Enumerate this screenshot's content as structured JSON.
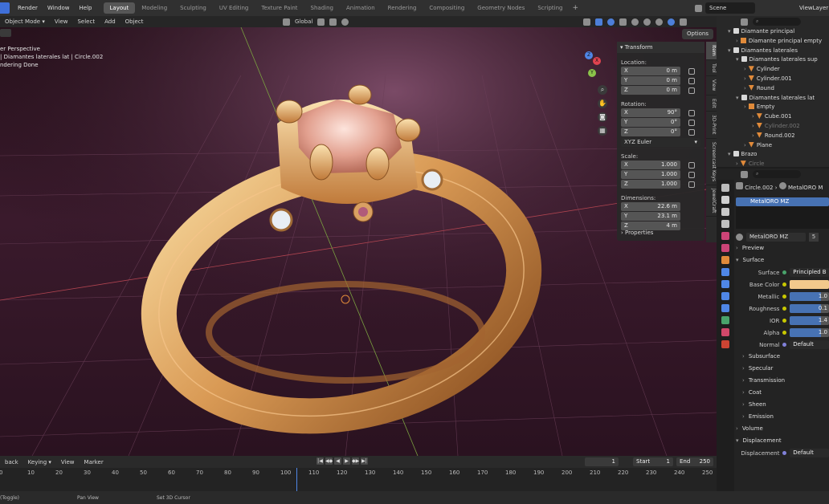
{
  "topbar": {
    "menus": [
      "Render",
      "Window",
      "Help"
    ],
    "workspaces": [
      "Layout",
      "Modeling",
      "Sculpting",
      "UV Editing",
      "Texture Paint",
      "Shading",
      "Animation",
      "Rendering",
      "Compositing",
      "Geometry Nodes",
      "Scripting"
    ],
    "active_workspace": "Layout",
    "add_tab": "+",
    "scene": "Scene",
    "view_layer": "ViewLayer"
  },
  "viewport_header": {
    "mode": "Object Mode",
    "menus": [
      "View",
      "Select",
      "Add",
      "Object"
    ],
    "orientation": "Global",
    "options": "Options"
  },
  "viewport_info": {
    "line1": "er Perspective",
    "line2": "| Diamantes laterales lat | Circle.002",
    "line3": "ndering Done"
  },
  "gizmo": {
    "x": "X",
    "y": "Y",
    "z": "Z"
  },
  "npanel": {
    "title": "Transform",
    "location_label": "Location:",
    "location": [
      {
        "axis": "X",
        "value": "0 m"
      },
      {
        "axis": "Y",
        "value": "0 m"
      },
      {
        "axis": "Z",
        "value": "0 m"
      }
    ],
    "rotation_label": "Rotation:",
    "rotation": [
      {
        "axis": "X",
        "value": "90°"
      },
      {
        "axis": "Y",
        "value": "0°"
      },
      {
        "axis": "Z",
        "value": "0°"
      }
    ],
    "rotation_mode": "XYZ Euler",
    "scale_label": "Scale:",
    "scale": [
      {
        "axis": "X",
        "value": "1.000"
      },
      {
        "axis": "Y",
        "value": "1.000"
      },
      {
        "axis": "Z",
        "value": "1.000"
      }
    ],
    "dimensions_label": "Dimensions:",
    "dimensions": [
      {
        "axis": "X",
        "value": "22.6 m"
      },
      {
        "axis": "Y",
        "value": "23.1 m"
      },
      {
        "axis": "Z",
        "value": "4 m"
      }
    ],
    "properties": "Properties"
  },
  "side_tabs": [
    "Item",
    "Tool",
    "View",
    "Edit",
    "3D-Print",
    "Screencast Keys",
    "JewelCraft"
  ],
  "outliner": {
    "rows": [
      {
        "label": "Diamante principal",
        "kind": "col",
        "indent": 1
      },
      {
        "label": "Diamante principal empty",
        "kind": "empty",
        "indent": 2
      },
      {
        "label": "Diamantes laterales",
        "kind": "col",
        "indent": 1
      },
      {
        "label": "Diamantes laterales sup",
        "kind": "col",
        "indent": 2
      },
      {
        "label": "Cylinder",
        "kind": "mesh",
        "indent": 3
      },
      {
        "label": "Cylinder.001",
        "kind": "mesh",
        "indent": 3
      },
      {
        "label": "Round",
        "kind": "mesh",
        "indent": 3
      },
      {
        "label": "Diamantes laterales lat",
        "kind": "col",
        "indent": 2
      },
      {
        "label": "Empty",
        "kind": "empty",
        "indent": 3
      },
      {
        "label": "Cube.001",
        "kind": "mesh",
        "indent": 4
      },
      {
        "label": "Cylinder.002",
        "kind": "mesh",
        "indent": 4,
        "dim": true
      },
      {
        "label": "Round.002",
        "kind": "mesh",
        "indent": 4
      },
      {
        "label": "Plane",
        "kind": "mesh",
        "indent": 3
      },
      {
        "label": "Brazo",
        "kind": "col",
        "indent": 1
      },
      {
        "label": "Circle",
        "kind": "mesh",
        "indent": 2,
        "dim": true
      }
    ]
  },
  "properties": {
    "object": "Circle.002",
    "material_crumb": "MetalORO M",
    "slot": "MetalORO MZ",
    "material_name": "MetalORO MZ",
    "users": "5",
    "preview": "Preview",
    "surface_section": "Surface",
    "surface_label": "Surface",
    "surface_value": "Principled B",
    "rows": [
      {
        "label": "Base Color",
        "value": "",
        "kind": "color"
      },
      {
        "label": "Metallic",
        "value": "1.0",
        "kind": "bar"
      },
      {
        "label": "Roughness",
        "value": "0.1",
        "kind": "bar"
      },
      {
        "label": "IOR",
        "value": "1.4",
        "kind": "bar"
      },
      {
        "label": "Alpha",
        "value": "1.0",
        "kind": "bar"
      },
      {
        "label": "Normal",
        "value": "Default",
        "kind": "dark"
      }
    ],
    "subsections": [
      "Subsurface",
      "Specular",
      "Transmission",
      "Coat",
      "Sheen",
      "Emission"
    ],
    "volume": "Volume",
    "displacement_section": "Displacement",
    "displacement_label": "Displacement",
    "displacement_value": "Default"
  },
  "timeline": {
    "menus": [
      "back",
      "Keying",
      "View",
      "Marker"
    ],
    "current_frame": "1",
    "start_label": "Start",
    "start": "1",
    "end_label": "End",
    "end": "250",
    "ticks": [
      "0",
      "10",
      "20",
      "30",
      "40",
      "50",
      "60",
      "70",
      "80",
      "90",
      "100",
      "110",
      "120",
      "130",
      "140",
      "150",
      "160",
      "170",
      "180",
      "190",
      "200",
      "210",
      "220",
      "230",
      "240",
      "250"
    ]
  },
  "status": {
    "items": [
      "(Toggle)",
      "Pan View",
      "Set 3D Cursor"
    ]
  },
  "colors": {
    "accent": "#4772b3",
    "gold": "#e6b46e",
    "gem": "#e8a99a"
  }
}
